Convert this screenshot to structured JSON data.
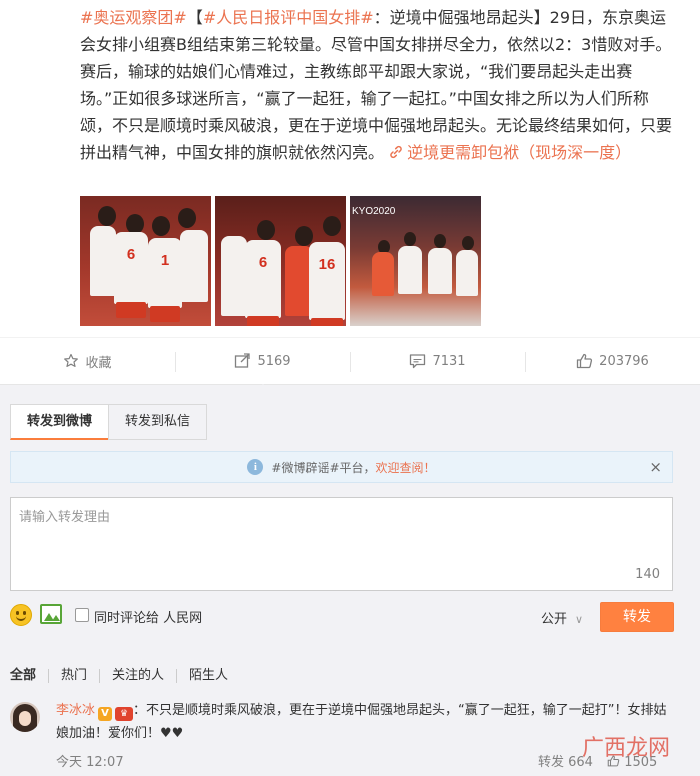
{
  "post": {
    "tag1": "#奥运观察团#",
    "open_bracket": "【",
    "tag2": "#人民日报评中国女排#",
    "body": "：逆境中倔强地昂起头】29日，东京奥运会女排小组赛B组结束第三轮较量。尽管中国女排拼尽全力，依然以2：3惜败对手。赛后，输球的姑娘们心情难过，主教练郎平却跟大家说，“我们要昂起头走出赛场。”正如很多球迷所言，“赢了一起狂，输了一起扛。”中国女排之所以为人们所称颂，不只是顺境时乘风破浪，更在于逆境中倔强地昂起头。无论最终结果如何，只要拼出精气神，中国女排的旗帜就依然闪亮。",
    "link_icon": "link-icon",
    "link_text": "逆境更需卸包袱（现场深一度）",
    "photo3_banner": "KYO2020"
  },
  "actions": {
    "favorite_label": "收藏",
    "repost_count": "5169",
    "comment_count": "7131",
    "like_count": "203796"
  },
  "forward": {
    "tabs": [
      "转发到微博",
      "转发到私信"
    ],
    "notice_prefix": "#微博辟谣#平台，",
    "notice_welcome": "欢迎查阅！",
    "close_glyph": "×",
    "placeholder": "请输入转发理由",
    "counter": "140",
    "also_comment_to": "同时评论给 人民网",
    "visibility": "公开",
    "visibility_caret": "∨",
    "submit": "转发"
  },
  "filters": [
    "全部",
    "热门",
    "关注的人",
    "陌生人"
  ],
  "comment": {
    "user": "李冰冰",
    "badge_v": "V",
    "badge_m": "♛",
    "text": "：不只是顺境时乘风破浪，更在于逆境中倔强地昂起头，“赢了一起狂，输了一起打”！女排姑娘加油！爱你们！♥♥",
    "time": "今天 12:07",
    "repost_label": "转发 664",
    "like_count": "1505"
  },
  "watermark": "广西龙网",
  "colors": {
    "accent": "#eb7350",
    "button": "#ff8140",
    "panel": "#f2f2f5"
  }
}
